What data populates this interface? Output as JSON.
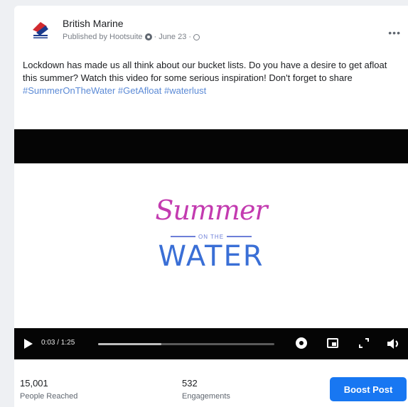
{
  "post": {
    "page_name": "British Marine",
    "published_by": "Published by Hootsuite",
    "date": "June 23",
    "more_label": "•••",
    "text": "Lockdown has made us all think about our bucket lists. Do you have a desire to get afloat this summer? Watch this video for some serious inspiration! Don't forget to share ",
    "hashtags": [
      "#SummerOnTheWater",
      "#GetAfloat",
      "#waterlust"
    ]
  },
  "video": {
    "summer_label": "Summer",
    "on_the_label": "ON THE",
    "water_label": "WATER",
    "time": "0:03 / 1:25",
    "progress": 0.36
  },
  "stats": {
    "reach_value": "15,001",
    "reach_label": "People Reached",
    "engagement_value": "532",
    "engagement_label": "Engagements",
    "boost_label": "Boost Post"
  },
  "colors": {
    "boost_button": "#1877f2",
    "hashtag": "#5b8ad6",
    "summer": "#c33bb0",
    "water": "#3a6fd6"
  },
  "icons": [
    "british-marine-logo-icon",
    "globe-icon",
    "gear-icon",
    "more-icon",
    "play-icon",
    "settings-icon",
    "picture-in-picture-icon",
    "expand-icon",
    "volume-icon"
  ]
}
